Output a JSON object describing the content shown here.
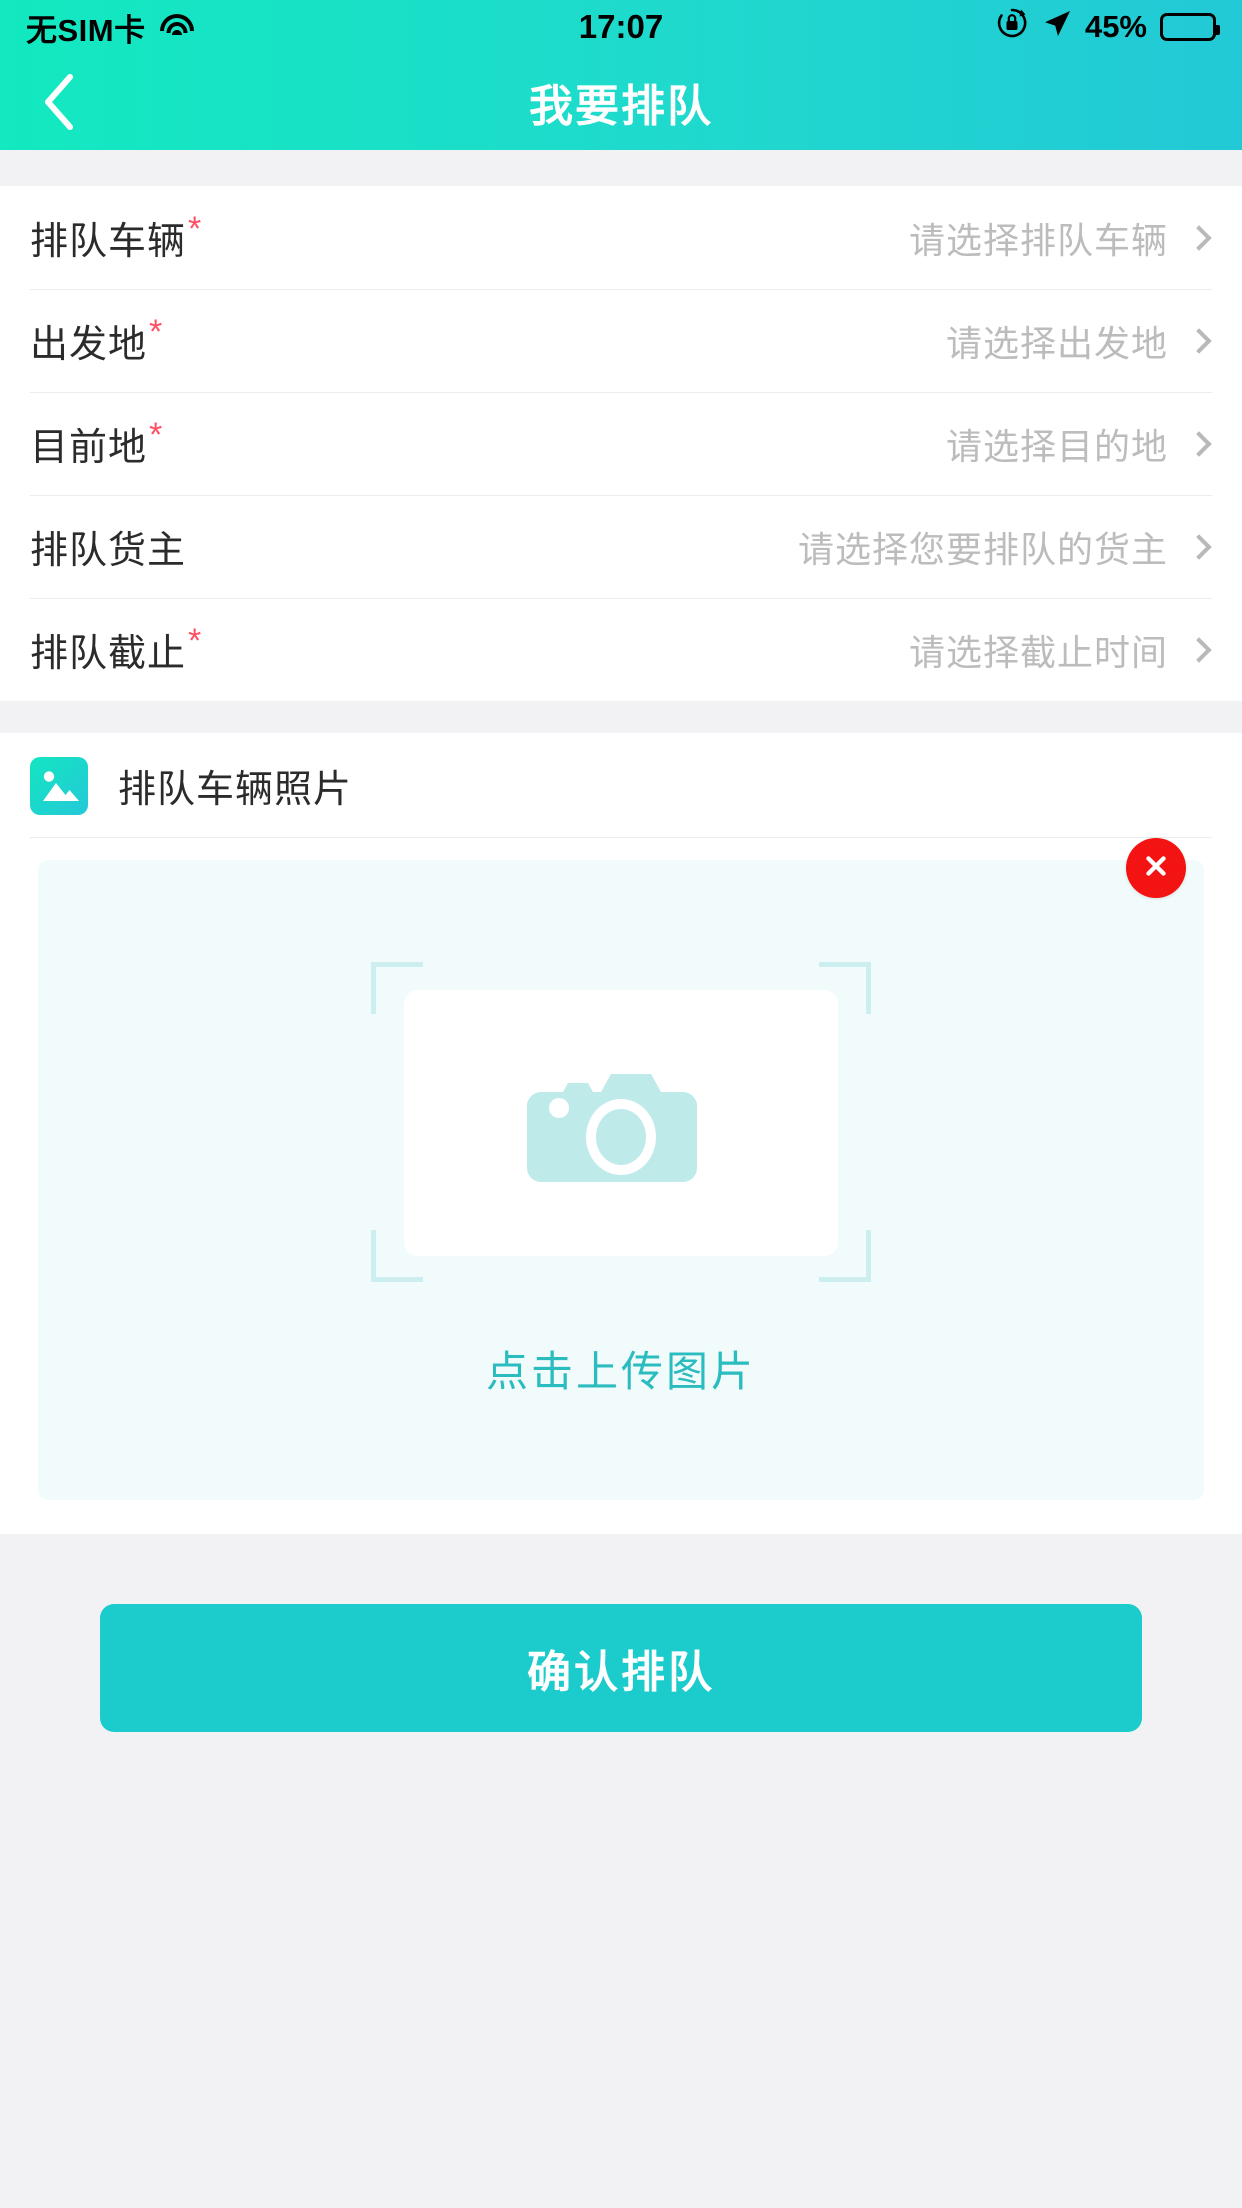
{
  "status_bar": {
    "carrier": "无SIM卡",
    "wifi_icon": "wifi-icon",
    "time": "17:07",
    "rotation_lock_icon": "rotation-lock-icon",
    "location_icon": "location-arrow-icon",
    "battery_percent": "45%",
    "battery_level": 45
  },
  "nav": {
    "back_icon": "chevron-left-icon",
    "title": "我要排队"
  },
  "form": {
    "rows": [
      {
        "label": "排队车辆",
        "required": true,
        "value": "请选择排队车辆",
        "chevron": "chevron-right-icon"
      },
      {
        "label": "出发地",
        "required": true,
        "value": "请选择出发地",
        "chevron": "chevron-right-icon"
      },
      {
        "label": "目前地",
        "required": true,
        "value": "请选择目的地",
        "chevron": "chevron-right-icon"
      },
      {
        "label": "排队货主",
        "required": false,
        "value": "请选择您要排队的货主",
        "chevron": "chevron-right-icon"
      },
      {
        "label": "排队截止",
        "required": true,
        "value": "请选择截止时间",
        "chevron": "chevron-right-icon"
      }
    ],
    "required_mark": "*"
  },
  "photo_section": {
    "icon": "image-icon",
    "title": "排队车辆照片",
    "close_icon": "close-circle-icon",
    "camera_icon": "camera-icon",
    "upload_text": "点击上传图片"
  },
  "submit": {
    "label": "确认排队"
  },
  "colors": {
    "header_gradient_start": "#12e9c0",
    "header_gradient_end": "#22c9d6",
    "accent_teal": "#1ccbcb",
    "upload_text": "#2bbcbf",
    "required_red": "#ff5064",
    "close_red": "#f31313",
    "placeholder_gray": "#bcbcbc",
    "label_dark": "#2b2b2b",
    "page_bg": "#f2f2f5",
    "upload_bg": "#f2fbfb"
  }
}
